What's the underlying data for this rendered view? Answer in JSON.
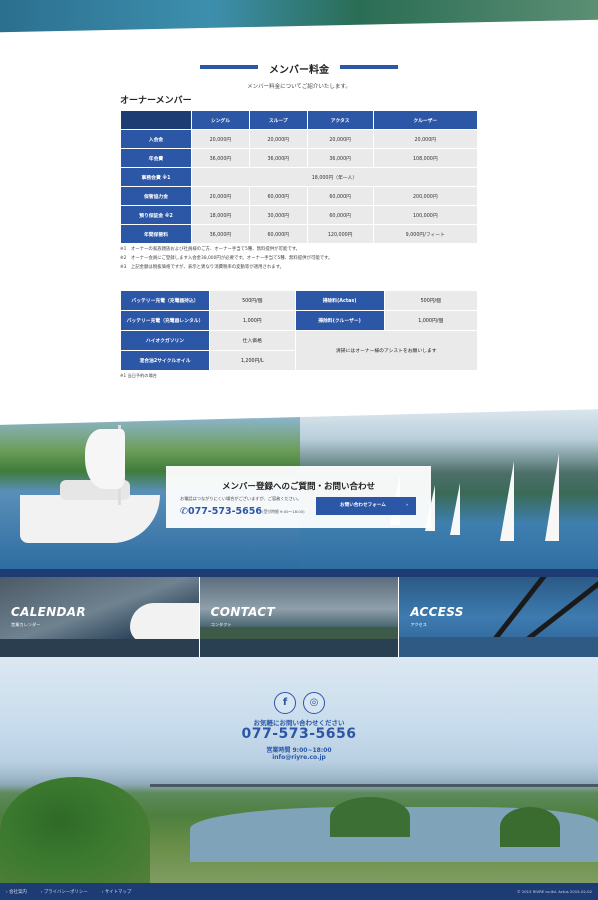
{
  "section": {
    "title": "メンバー料金",
    "subtitle": "メンバー料金についてご紹介いたします。"
  },
  "owner_member": {
    "label": "オーナーメンバー",
    "columns": [
      "シングル",
      "スループ",
      "アクタス",
      "クルーザー"
    ],
    "rows": [
      {
        "label": "入会金",
        "values": [
          "20,000円",
          "20,000円",
          "20,000円",
          "20,000円"
        ]
      },
      {
        "label": "年会費",
        "values": [
          "36,000円",
          "36,000円",
          "36,000円",
          "108,000円"
        ]
      },
      {
        "label": "事務会費",
        "sup": "※1",
        "merged": "18,000円（年一人）"
      },
      {
        "label": "保管協力金",
        "values": [
          "20,000円",
          "60,000円",
          "60,000円",
          "200,000円"
        ]
      },
      {
        "label": "預り保証金",
        "sup": "※2",
        "values": [
          "18,000円",
          "30,000円",
          "60,000円",
          "100,000円"
        ]
      },
      {
        "label": "年間保管料",
        "values": [
          "36,000円",
          "60,000円",
          "120,000円",
          "9,000円/フィート"
        ]
      }
    ],
    "notes": [
      "※1　オーナーの家族親族および社員様のご方、オーナー手当て5種、無料提供が可能です。",
      "※2　オーナー会員にご登録します入会金38,000円が必要です。オーナー手当て5種、無料提供が可能です。",
      "※3　上記金額は税抜価格ですが、表示と異なり消費税率の変動等が適用されます。"
    ]
  },
  "options": {
    "rows": [
      {
        "label": "バッテリー充電（充電器持込）",
        "value": "500円/個"
      },
      {
        "label": "バッテリー充電（充電器レンタル）",
        "value": "1,000円"
      },
      {
        "label": "ハイオクガソリン",
        "value": "仕入価格"
      },
      {
        "label": "混合油2サイクルオイル",
        "value": "1,200円/L"
      }
    ],
    "right_rows": [
      {
        "label": "掃除料(Actas)",
        "value": "500円/個"
      },
      {
        "label": "掃除料(クルーザー)",
        "value": "1,000円/個"
      }
    ],
    "merged_note": "清掃にはオーナー様のアシストをお願いします",
    "footnote": "※1 当日予約の場合"
  },
  "inquiry": {
    "title": "メンバー登録へのご質問・お問い合わせ",
    "sub": "お電話はつながりにくい場合がございますが、ご容赦ください。",
    "phone": "077-573-5656",
    "hours": "(受付時間 9:00〜18:00)",
    "button": "お問い合わせフォーム",
    "button_arrow": "›"
  },
  "tiles": [
    {
      "en": "CALENDAR",
      "ja": "営業カレンダー"
    },
    {
      "en": "CONTACT",
      "ja": "コンタクト"
    },
    {
      "en": "ACCESS",
      "ja": "アクセス"
    }
  ],
  "footer": {
    "facebook_glyph": "f",
    "instagram_glyph": "◎",
    "prompt": "お気軽にお問い合わせください",
    "phone": "077-573-5656",
    "hours": "営業時間 9:00~18:00",
    "email": "info@riyre.co.jp"
  },
  "bottom": {
    "links": [
      "会社案内",
      "プライバシーポリシー",
      "サイトマップ"
    ],
    "copyright": "© 2015 RIVRE co.ltd. Actus 2015-02-02"
  },
  "colors": {
    "accent": "#2c56a6",
    "navy": "#1d3c73"
  }
}
